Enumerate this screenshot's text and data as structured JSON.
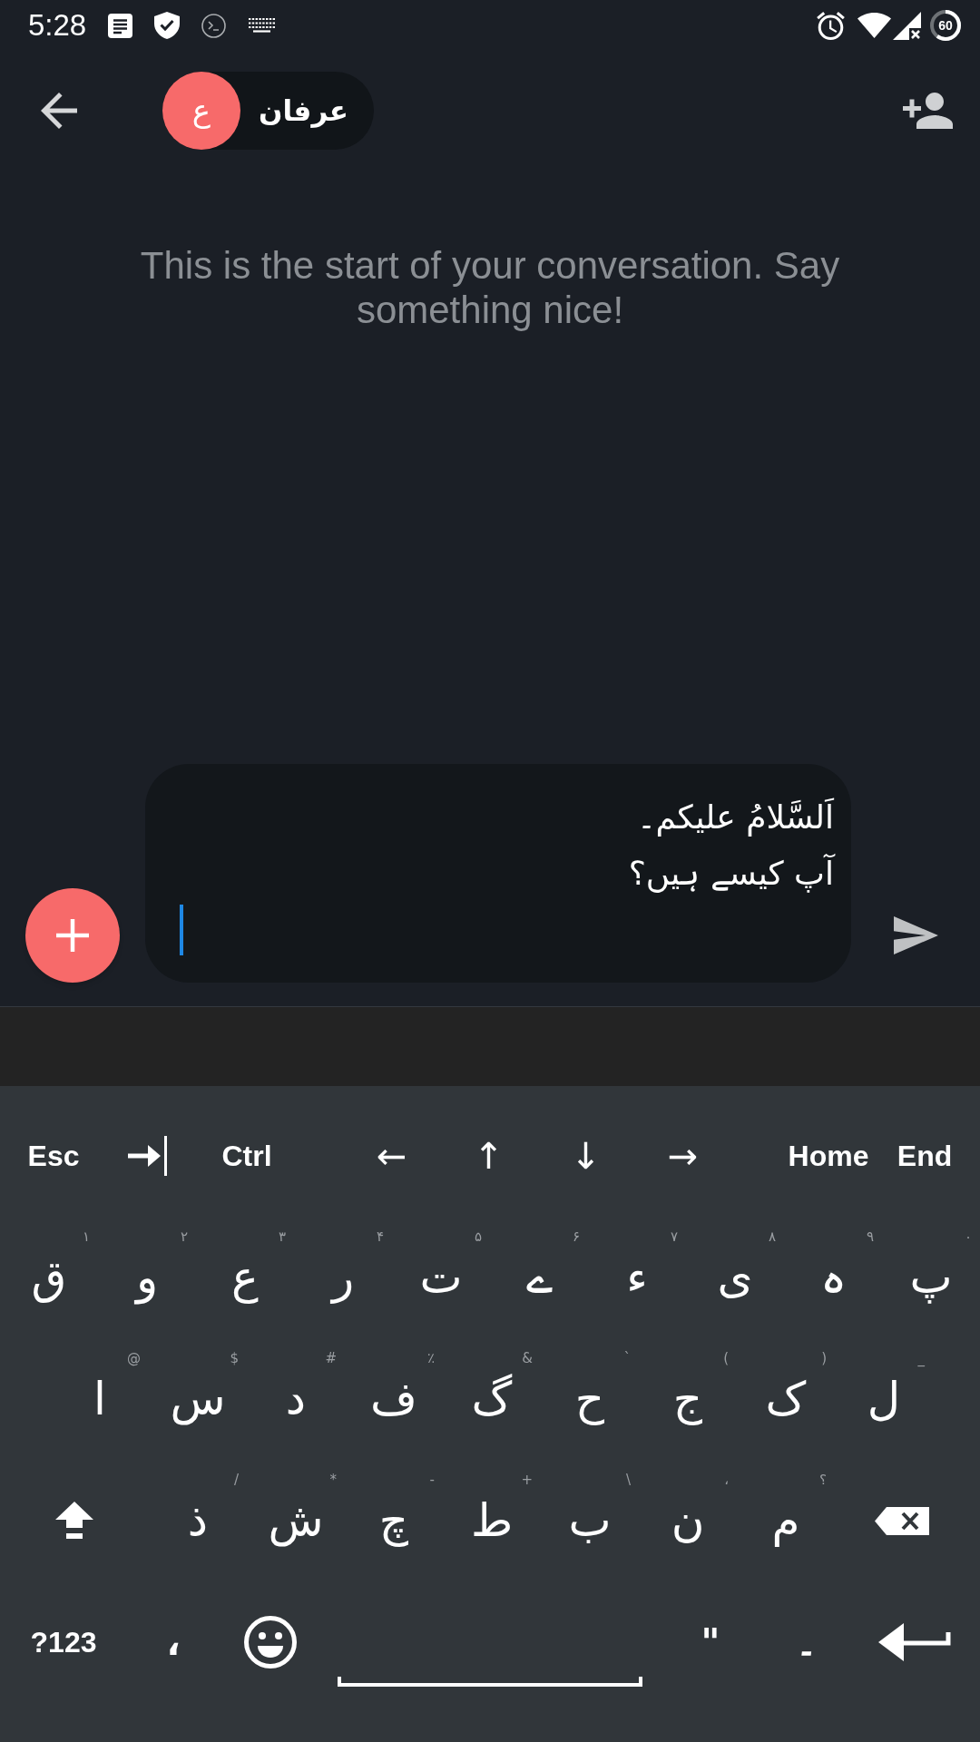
{
  "status_bar": {
    "time": "5:28",
    "battery": "60"
  },
  "header": {
    "contact": {
      "initial": "ع",
      "name": "عرفان"
    }
  },
  "conversation": {
    "notice": "This is the start of your conversation. Say something nice!"
  },
  "composer": {
    "lines": [
      "اَلسَّلامُ علیکم۔",
      "آپ کیسے ہیں؟"
    ]
  },
  "keyboard": {
    "top_row": [
      {
        "kind": "text",
        "label": "Esc"
      },
      {
        "kind": "tab"
      },
      {
        "kind": "text",
        "label": "Ctrl"
      },
      {
        "kind": "arrow",
        "label": "←"
      },
      {
        "kind": "arrow",
        "label": "↑"
      },
      {
        "kind": "arrow",
        "label": "↓"
      },
      {
        "kind": "arrow",
        "label": "→"
      },
      {
        "kind": "text",
        "label": "Home"
      },
      {
        "kind": "text",
        "label": "End"
      }
    ],
    "rows": [
      [
        {
          "kind": "letter",
          "label": "ق",
          "hint": "۱"
        },
        {
          "kind": "letter",
          "label": "و",
          "hint": "۲"
        },
        {
          "kind": "letter",
          "label": "ع",
          "hint": "۳"
        },
        {
          "kind": "letter",
          "label": "ر",
          "hint": "۴"
        },
        {
          "kind": "letter",
          "label": "ت",
          "hint": "۵"
        },
        {
          "kind": "letter",
          "label": "ے",
          "hint": "۶"
        },
        {
          "kind": "letter",
          "label": "ء",
          "hint": "۷"
        },
        {
          "kind": "letter",
          "label": "ی",
          "hint": "۸"
        },
        {
          "kind": "letter",
          "label": "ہ",
          "hint": "۹"
        },
        {
          "kind": "letter",
          "label": "پ",
          "hint": "۰"
        }
      ],
      [
        {
          "kind": "letter",
          "label": "ا",
          "hint": "@"
        },
        {
          "kind": "letter",
          "label": "س",
          "hint": "$"
        },
        {
          "kind": "letter",
          "label": "د",
          "hint": "#"
        },
        {
          "kind": "letter",
          "label": "ف",
          "hint": "٪"
        },
        {
          "kind": "letter",
          "label": "گ",
          "hint": "&"
        },
        {
          "kind": "letter",
          "label": "ح",
          "hint": "`"
        },
        {
          "kind": "letter",
          "label": "ج",
          "hint": "("
        },
        {
          "kind": "letter",
          "label": "ک",
          "hint": ")"
        },
        {
          "kind": "letter",
          "label": "ل",
          "hint": "_"
        }
      ],
      [
        {
          "kind": "shift"
        },
        {
          "kind": "letter",
          "label": "ذ",
          "hint": "/"
        },
        {
          "kind": "letter",
          "label": "ش",
          "hint": "*"
        },
        {
          "kind": "letter",
          "label": "چ",
          "hint": "-"
        },
        {
          "kind": "letter",
          "label": "ط",
          "hint": "+"
        },
        {
          "kind": "letter",
          "label": "ب",
          "hint": "\\"
        },
        {
          "kind": "letter",
          "label": "ن",
          "hint": "،"
        },
        {
          "kind": "letter",
          "label": "م",
          "hint": "؟"
        },
        {
          "kind": "backspace"
        }
      ]
    ],
    "bottom_row": [
      {
        "kind": "text",
        "label": "?123"
      },
      {
        "kind": "punct",
        "label": "،"
      },
      {
        "kind": "emoji"
      },
      {
        "kind": "space"
      },
      {
        "kind": "punct",
        "label": "\""
      },
      {
        "kind": "punct",
        "label": "۔"
      },
      {
        "kind": "enter"
      }
    ]
  }
}
